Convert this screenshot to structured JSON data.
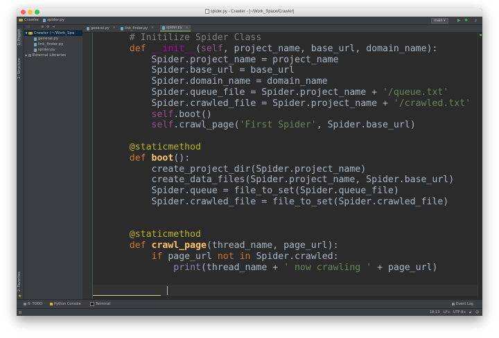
{
  "window": {
    "title": "spider.py - Crawler - [~/Work_Space/Crawler]"
  },
  "navbar": {
    "breadcrumb": [
      "Crawler",
      "spider.py"
    ],
    "run_config": "main",
    "run_icon": "play-icon",
    "debug_icon": "bug-icon",
    "search_icon": "search-icon"
  },
  "sidebar": {
    "left_tabs": [
      "1: Project",
      "2: Structure",
      "2: Favorites"
    ]
  },
  "project_tree": {
    "root": "Crawler (~/Work_Spa",
    "files": [
      "general.py",
      "link_finder.py",
      "spider.py"
    ],
    "external": "External Libraries"
  },
  "tabs": [
    {
      "label": "general.py",
      "active": false
    },
    {
      "label": "link_finder.py",
      "active": false
    },
    {
      "label": "spider.py",
      "active": true
    }
  ],
  "code": {
    "language": "python",
    "lines": [
      "    # Initilize Spider Class",
      "    def __init__(self, project_name, base_url, domain_name):",
      "        Spider.project_name = project_name",
      "        Spider.base_url = base_url",
      "        Spider.domain_name = domain_name",
      "        Spider.queue_file = Spider.project_name + '/queue.txt'",
      "        Spider.crawled_file = Spider.project_name + '/crawled.txt'",
      "        self.boot()",
      "        self.crawl_page('First Spider', Spider.base_url)",
      "",
      "    @staticmethod",
      "    def boot():",
      "        create_project_dir(Spider.project_name)",
      "        create_data_files(Spider.project_name, Spider.base_url)",
      "        Spider.queue = file_to_set(Spider.queue_file)",
      "        Spider.crawled_file = file_to_set(Spider.crawled_file)",
      "",
      "",
      "    @staticmethod",
      "    def crawl_page(thread_name, page_url):",
      "        if page_url not in Spider.crawled:",
      "            print(thread_name + ' now crawling ' + page_url)",
      ""
    ]
  },
  "bottom_tools": [
    "6: TODO",
    "Python Console",
    "Terminal"
  ],
  "event_log": "Event Log",
  "status": {
    "position": "18:13",
    "line_sep": "LF÷",
    "encoding": "UTF-8÷"
  },
  "colors": {
    "editor_bg": "#2b2b2b",
    "keyword": "#cc7832",
    "string": "#6a8759",
    "self": "#94558d",
    "decorator": "#bbb529",
    "function": "#ffc66d",
    "comment": "#808080"
  }
}
